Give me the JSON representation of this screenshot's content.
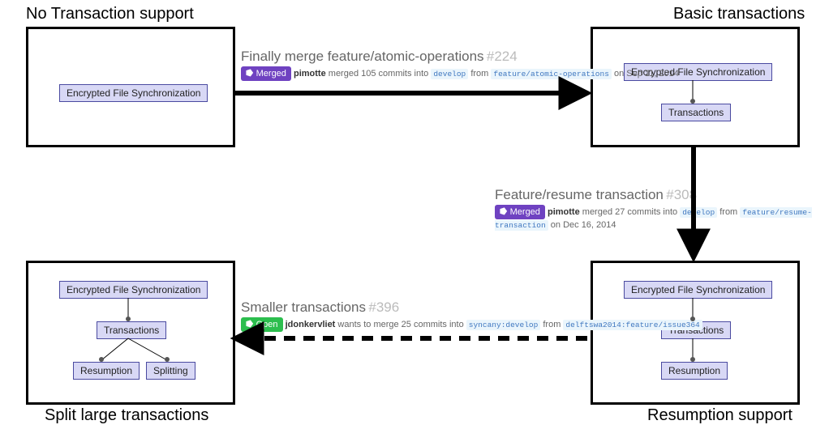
{
  "stages": {
    "a": {
      "title": "No Transaction support"
    },
    "b": {
      "title": "Basic transactions"
    },
    "c": {
      "title": "Resumption support"
    },
    "d": {
      "title": "Split large transactions"
    }
  },
  "nodes": {
    "efs": "Encrypted File Synchronization",
    "trans": "Transactions",
    "resume": "Resumption",
    "split": "Splitting"
  },
  "prs": {
    "pr1": {
      "title": "Finally merge feature/atomic-operations",
      "number": "#224",
      "status": "Merged",
      "user": "pimotte",
      "action": "merged 105 commits into",
      "base": "develop",
      "from_word": "from",
      "head": "feature/atomic-operations",
      "date": "on Sep 11, 2014"
    },
    "pr2": {
      "title": "Feature/resume transaction",
      "number": "#308",
      "status": "Merged",
      "user": "pimotte",
      "action": "merged 27 commits into",
      "base": "develop",
      "from_word": "from",
      "head": "feature/resume-transaction",
      "date": "on Dec 16, 2014"
    },
    "pr3": {
      "title": "Smaller transactions",
      "number": "#396",
      "status": "Open",
      "user": "jdonkervliet",
      "action": "wants to merge 25 commits into",
      "base": "syncany:develop",
      "from_word": "from",
      "head": "delftswa2014:feature/issue364",
      "date": ""
    }
  }
}
